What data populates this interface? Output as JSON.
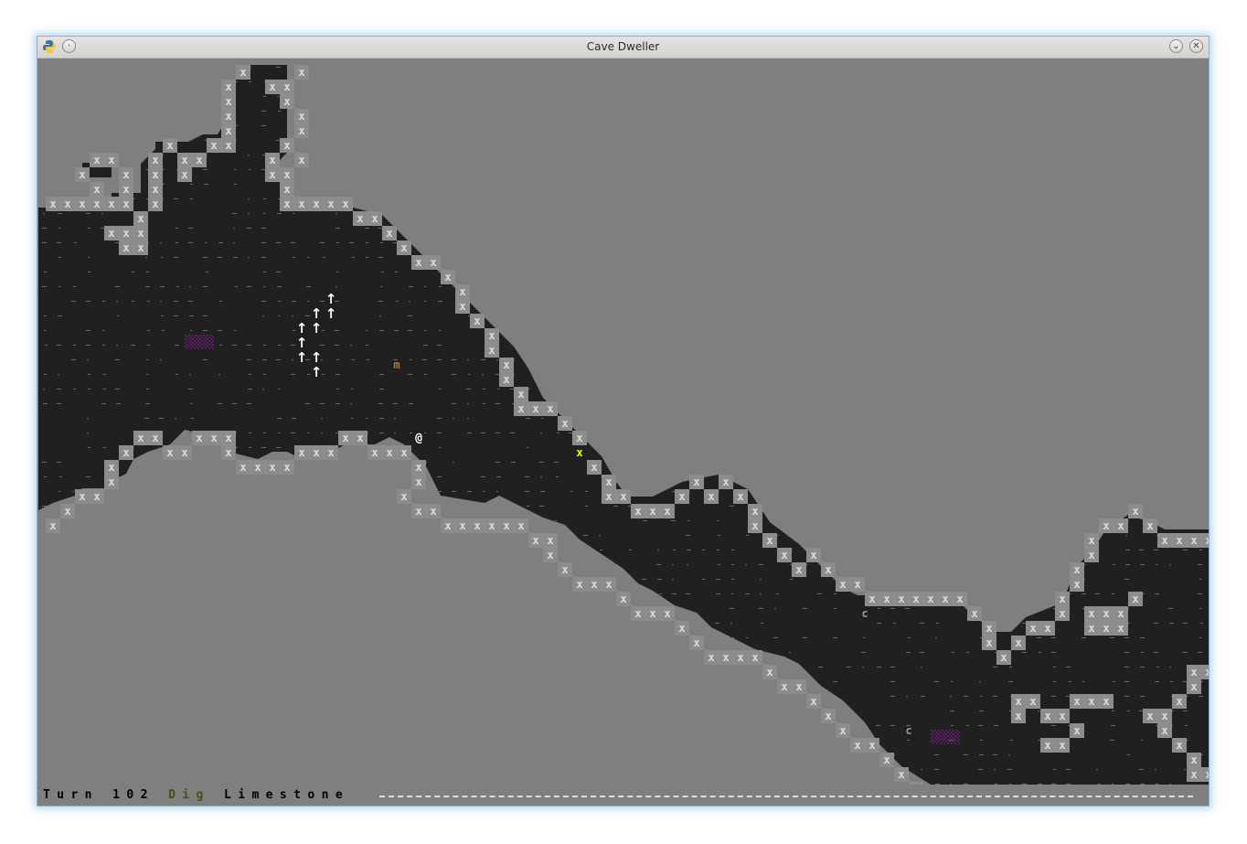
{
  "window": {
    "title": "Cave Dweller",
    "app_icon": "python-icon",
    "buttons": [
      "menu-icon",
      "chevron-down-icon",
      "close-icon"
    ]
  },
  "status_bar": {
    "turn_label": "Turn",
    "turn_value": "102",
    "action": "Dig",
    "target": "Limestone"
  },
  "colors": {
    "background_stone": "#7f7f7f",
    "cave_floor": "#202020",
    "wall_marker": "#dcdcdc",
    "selected_wall": "#ffff00",
    "player": "#ffffff",
    "monster_m": "#b07a30",
    "monster_c": "#9a9a9a",
    "purple_pool": "#8a1aa0"
  },
  "legend": {
    "player": "@",
    "wall": "x",
    "selected_wall": "x",
    "monster_m": "m",
    "monster_c": "c",
    "tree": "↑"
  }
}
